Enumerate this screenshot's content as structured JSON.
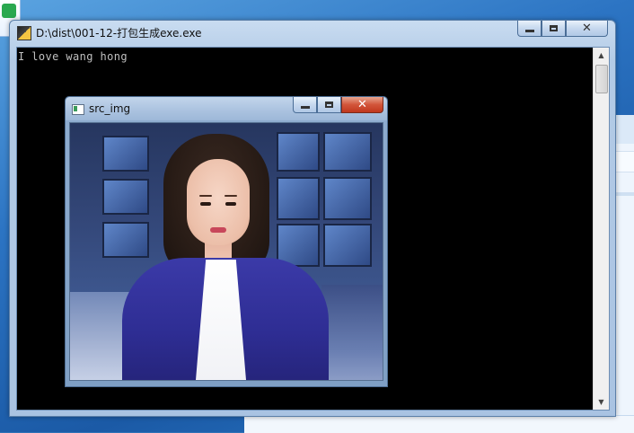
{
  "console_window": {
    "title": "D:\\dist\\001-12-打包生成exe.exe",
    "output_text": "I love wang hong",
    "buttons": {
      "minimize_icon": "minimize-icon",
      "maximize_icon": "maximize-icon",
      "close_icon": "close-icon"
    },
    "scrollbar": {
      "up_arrow": "▲",
      "down_arrow": "▼"
    }
  },
  "image_window": {
    "title": "src_img",
    "image_description_icon": "photo-news-anchor",
    "buttons": {
      "close_glyph": "✕"
    }
  },
  "console_buttons": {
    "close_glyph": "✕"
  },
  "colors": {
    "console_background": "#000000",
    "console_text": "#c0c0c0",
    "close_button_red": "#c0381e",
    "window_frame_blue": "#a9c3e2"
  }
}
